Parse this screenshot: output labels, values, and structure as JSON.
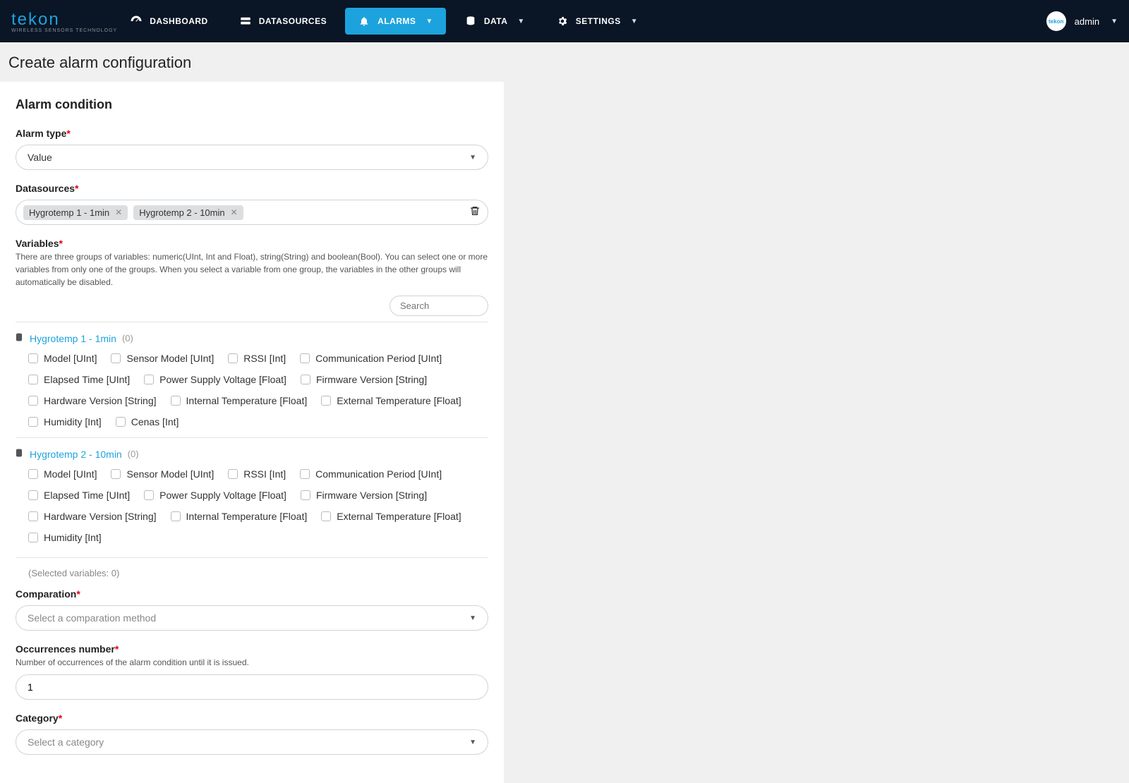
{
  "logo": {
    "main": "tekon",
    "sub": "WIRELESS SENSORS TECHNOLOGY"
  },
  "nav": {
    "dashboard": "DASHBOARD",
    "datasources": "DATASOURCES",
    "alarms": "ALARMS",
    "data": "DATA",
    "settings": "SETTINGS"
  },
  "user": {
    "name": "admin"
  },
  "page_title": "Create alarm configuration",
  "section_title": "Alarm condition",
  "fields": {
    "alarm_type": {
      "label": "Alarm type",
      "value": "Value"
    },
    "datasources": {
      "label": "Datasources",
      "chips": [
        "Hygrotemp 1 - 1min",
        "Hygrotemp 2 - 10min"
      ]
    },
    "variables": {
      "label": "Variables",
      "help": "There are three groups of variables: numeric(UInt, Int and Float), string(String) and boolean(Bool). You can select one or more variables from only one of the groups. When you select a variable from one group, the variables in the other groups will automatically be disabled.",
      "search_placeholder": "Search",
      "groups": [
        {
          "name": "Hygrotemp 1 - 1min",
          "count": "(0)",
          "vars": [
            "Model [UInt]",
            "Sensor Model [UInt]",
            "RSSI [Int]",
            "Communication Period [UInt]",
            "Elapsed Time [UInt]",
            "Power Supply Voltage [Float]",
            "Firmware Version [String]",
            "Hardware Version [String]",
            "Internal Temperature [Float]",
            "External Temperature [Float]",
            "Humidity [Int]",
            "Cenas [Int]"
          ]
        },
        {
          "name": "Hygrotemp 2 - 10min",
          "count": "(0)",
          "vars": [
            "Model [UInt]",
            "Sensor Model [UInt]",
            "RSSI [Int]",
            "Communication Period [UInt]",
            "Elapsed Time [UInt]",
            "Power Supply Voltage [Float]",
            "Firmware Version [String]",
            "Hardware Version [String]",
            "Internal Temperature [Float]",
            "External Temperature [Float]",
            "Humidity [Int]"
          ]
        }
      ],
      "selected_summary": "(Selected variables: 0)"
    },
    "comparation": {
      "label": "Comparation",
      "placeholder": "Select a comparation method"
    },
    "occurrences": {
      "label": "Occurrences number",
      "help": "Number of occurrences of the alarm condition until it is issued.",
      "value": "1"
    },
    "category": {
      "label": "Category",
      "placeholder": "Select a category"
    }
  }
}
